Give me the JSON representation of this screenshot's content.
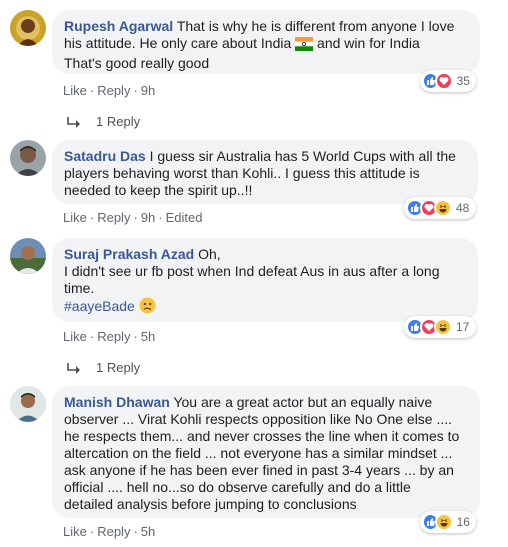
{
  "comments": [
    {
      "author": "Rupesh Agarwal",
      "text_line1": "That is why he is different from anyone I love",
      "text_line2": "his attitude. He only care about India",
      "text_line2b": "and win for India",
      "text_line3": "That's good really good",
      "actions": {
        "like": "Like",
        "reply": "Reply",
        "time": "9h"
      },
      "reaction_count": "35",
      "replies_label": "1 Reply"
    },
    {
      "author": "Satadru Das",
      "text_line1": "I guess sir Australia has 5 World Cups with all the",
      "text_line2": "players behaving worst than Kohli.. I guess this attitude is",
      "text_line3": "needed to keep the spirit up..!!",
      "actions": {
        "like": "Like",
        "reply": "Reply",
        "time": "9h",
        "edited": "Edited"
      },
      "reaction_count": "48"
    },
    {
      "author": "Suraj Prakash Azad",
      "text_line1": "Oh,",
      "text_line2": "I didn't see ur fb post when Ind defeat Aus in aus after a long",
      "text_line3": "time.",
      "hashtag": "#aayeBade",
      "actions": {
        "like": "Like",
        "reply": "Reply",
        "time": "5h"
      },
      "reaction_count": "17",
      "replies_label": "1 Reply"
    },
    {
      "author": "Manish Dhawan",
      "text_line1": "You are a great actor but an equally naive",
      "text_line2": "observer ... Virat Kohli respects opposition like No One else ....",
      "text_line3": "he respects them... and never crosses the line when it comes to",
      "text_line4": "altercation on the field ... not everyone has a similar mindset ...",
      "text_line5": "ask anyone if he has been ever fined in past 3-4 years ... by an",
      "text_line6": "official .... hell no...so do observe carefully and do a little",
      "text_line7": "detailed analysis before jumping to conclusions",
      "actions": {
        "like": "Like",
        "reply": "Reply",
        "time": "5h"
      },
      "reaction_count": "16"
    }
  ],
  "colors": {
    "author": "#385898",
    "bubble": "#f2f3f5",
    "like": "#3b7cf4",
    "love": "#f33e58",
    "haha": "#f7c33b"
  },
  "icons": [
    "like-icon",
    "love-icon",
    "haha-icon",
    "india-flag-icon",
    "confused-face-icon",
    "reply-arrow-icon"
  ]
}
